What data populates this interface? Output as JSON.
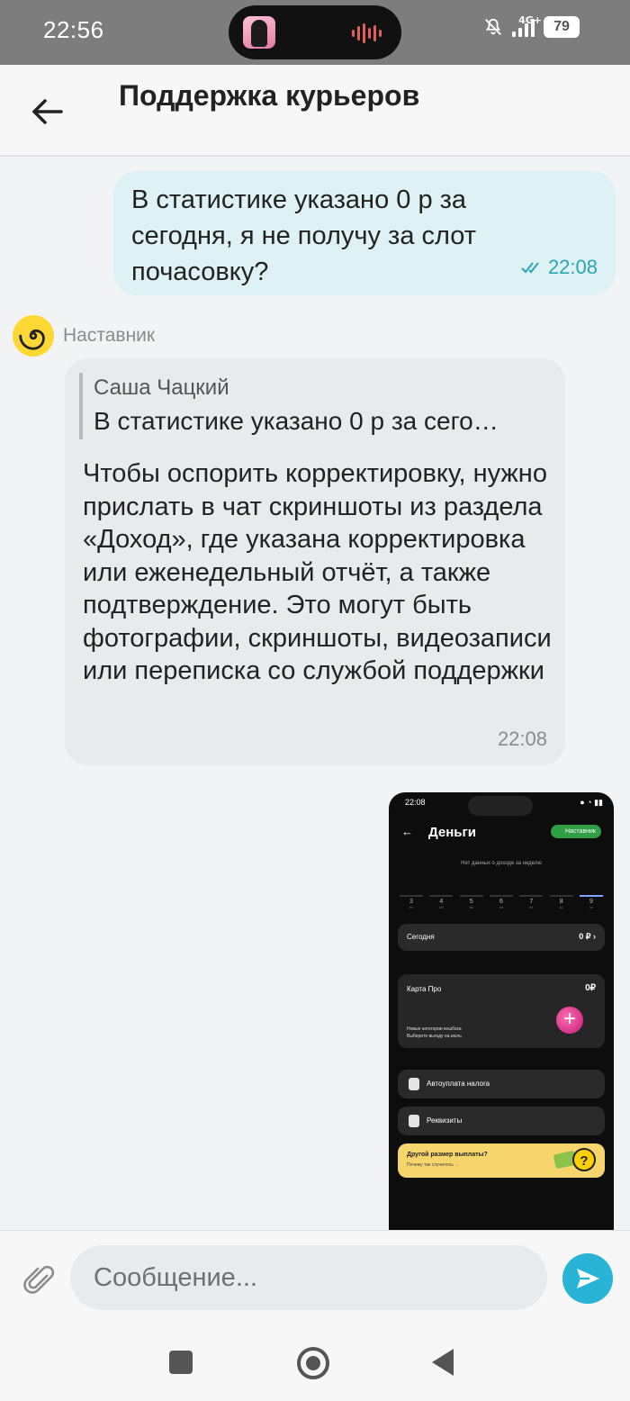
{
  "status_bar": {
    "time": "22:56",
    "network": "4G+",
    "battery": "79"
  },
  "header": {
    "title": "Поддержка курьеров"
  },
  "messages": {
    "outgoing": {
      "text": "В статистике указано 0 р за сегодня, я не получу за слот почасовку?",
      "time": "22:08",
      "status_icon": "double-check-icon"
    },
    "incoming": {
      "sender": "Наставник",
      "quote_author": "Саша Чацкий",
      "quote_text": "В статистике указано 0 р за сего…",
      "text": "Чтобы оспорить корректировку, нужно прислать в чат скриншоты из раздела «Доход», где указана корректировка или еженедельный отчёт, а также подтверждение. Это могут быть фотографии, скриншоты, видеозаписи или переписка со службой поддержки",
      "time": "22:08"
    },
    "image": {
      "time": "22:08",
      "title": "Деньги",
      "mentor_label": "Наставник",
      "no_data": "Нет данных о доходе за неделю",
      "days": [
        {
          "n": "3",
          "w": "пт"
        },
        {
          "n": "4",
          "w": "сб"
        },
        {
          "n": "5",
          "w": "вс"
        },
        {
          "n": "6",
          "w": "пн"
        },
        {
          "n": "7",
          "w": "вт"
        },
        {
          "n": "8",
          "w": "ср"
        },
        {
          "n": "9",
          "w": "чт"
        }
      ],
      "today_label": "Сегодня",
      "today_value": "0 ₽ ›",
      "card_label": "Карта Про",
      "card_value": "0₽",
      "card_desc1": "Новые категории кешбэка",
      "card_desc2": "Выберите выгоду на июль",
      "tax_label": "Автоуплата налога",
      "requisites_label": "Реквизиты",
      "promo_title": "Другой размер выплаты?",
      "promo_desc": "Почему так случилось →"
    }
  },
  "composer": {
    "placeholder": "Сообщение..."
  },
  "colors": {
    "accent": "#28b4d6",
    "outgoing_bubble": "#def1f4",
    "incoming_bubble": "#e9eaec",
    "status_bar": "#7d7d7d"
  }
}
